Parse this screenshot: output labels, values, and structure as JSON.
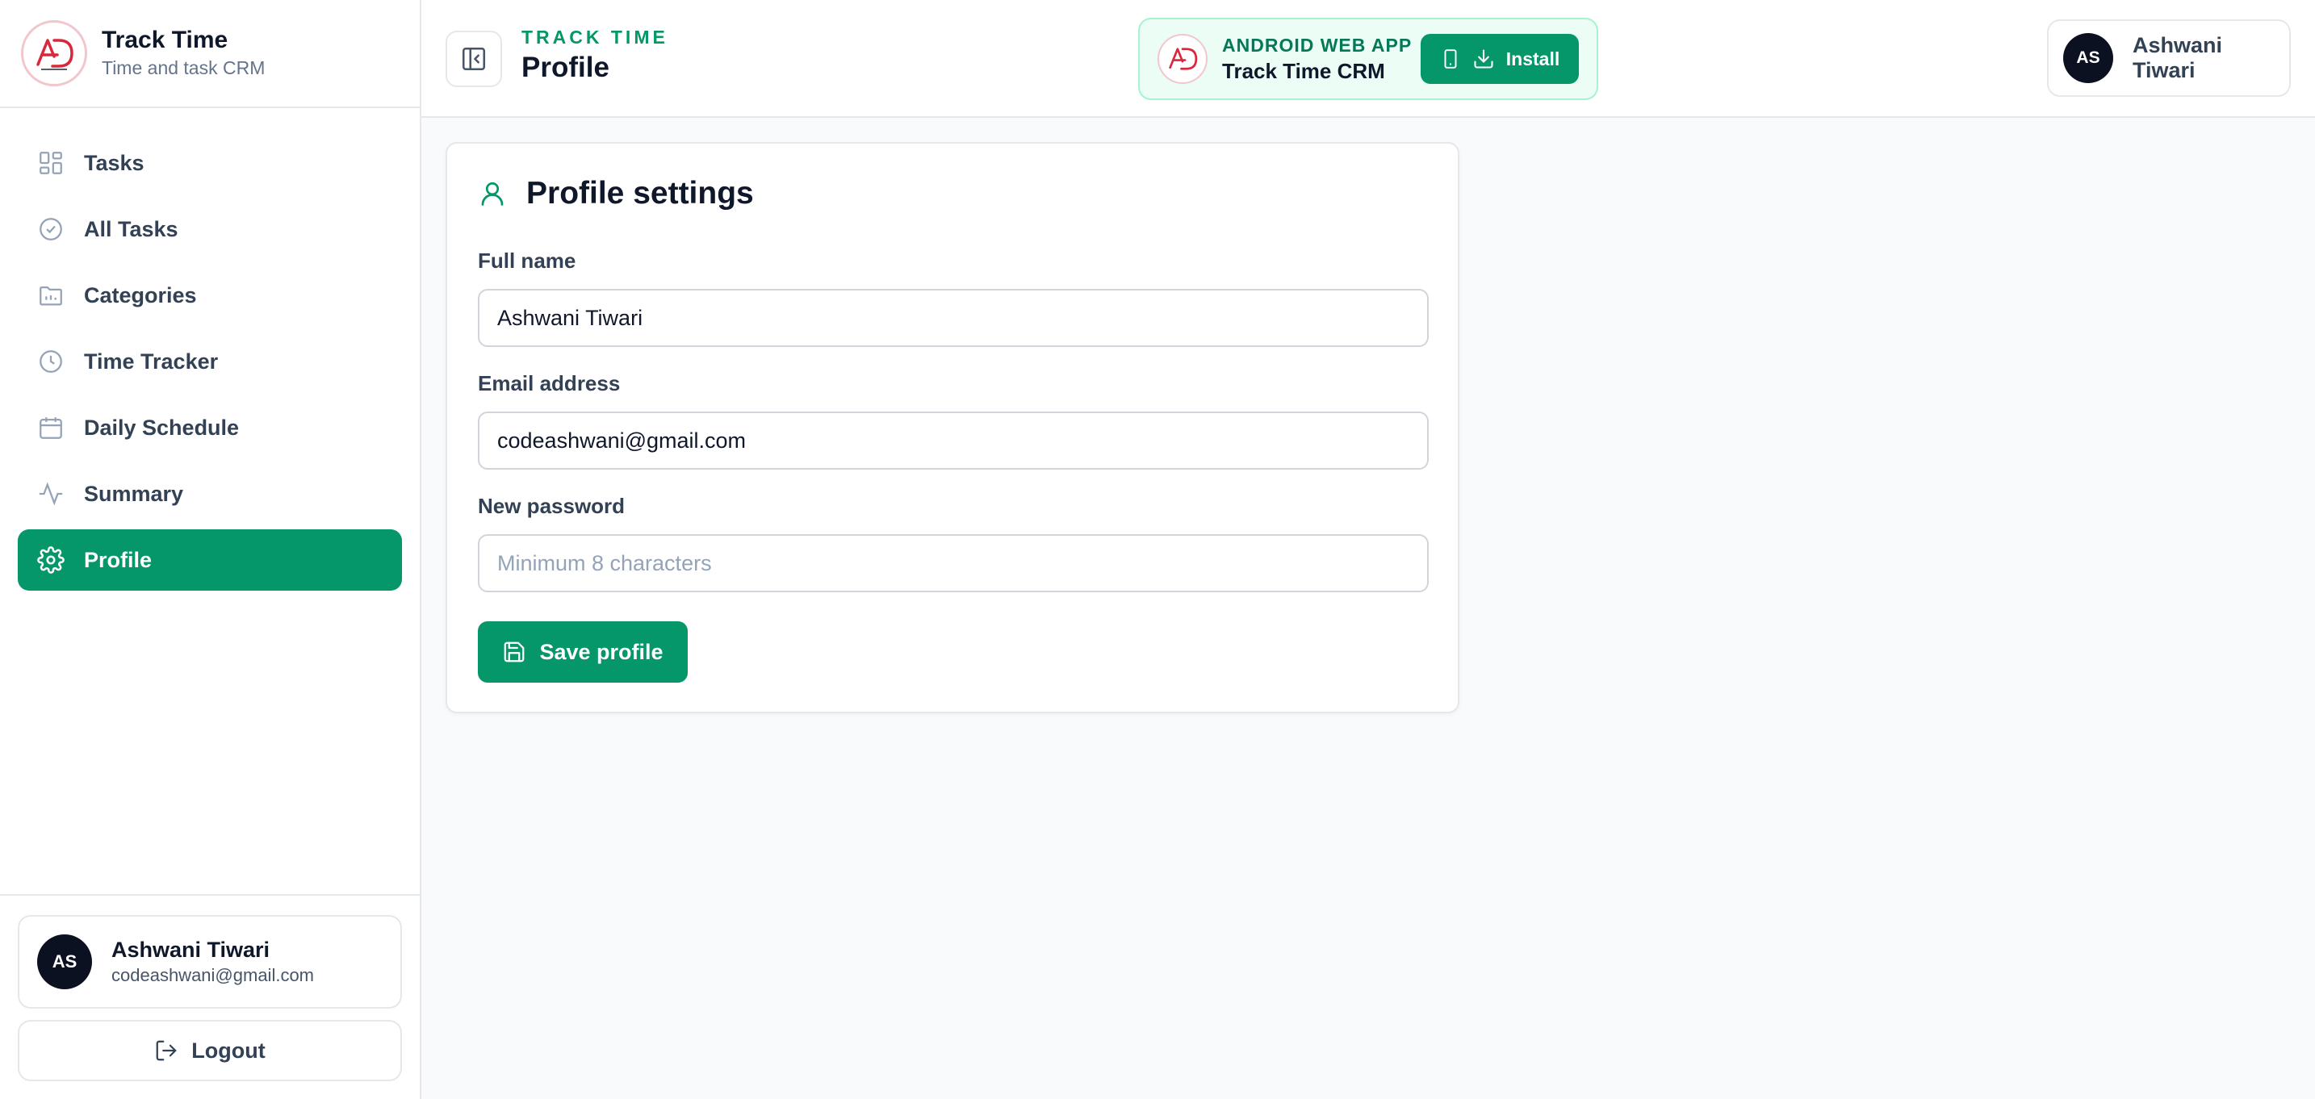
{
  "brand": {
    "title": "Track Time",
    "subtitle": "Time and task CRM",
    "logo_icon": "ad-logo-icon"
  },
  "sidebar": {
    "items": [
      {
        "label": "Tasks",
        "icon": "grid-icon",
        "active": false
      },
      {
        "label": "All Tasks",
        "icon": "check-circle-icon",
        "active": false
      },
      {
        "label": "Categories",
        "icon": "folder-icon",
        "active": false
      },
      {
        "label": "Time Tracker",
        "icon": "clock-icon",
        "active": false
      },
      {
        "label": "Daily Schedule",
        "icon": "calendar-icon",
        "active": false
      },
      {
        "label": "Summary",
        "icon": "activity-icon",
        "active": false
      },
      {
        "label": "Profile",
        "icon": "gear-icon",
        "active": true
      }
    ],
    "user": {
      "initials": "AS",
      "name": "Ashwani Tiwari",
      "email": "codeashwani@gmail.com"
    },
    "logout_label": "Logout"
  },
  "header": {
    "eyebrow": "TRACK TIME",
    "title": "Profile",
    "banner": {
      "eyebrow": "ANDROID WEB APP",
      "title": "Track Time CRM",
      "install_label": "Install"
    },
    "user": {
      "initials": "AS",
      "name": "Ashwani Tiwari"
    }
  },
  "profile": {
    "title": "Profile settings",
    "full_name_label": "Full name",
    "full_name_value": "Ashwani Tiwari",
    "email_label": "Email address",
    "email_value": "codeashwani@gmail.com",
    "password_label": "New password",
    "password_placeholder": "Minimum 8 characters",
    "save_label": "Save profile"
  },
  "colors": {
    "accent": "#059669",
    "accent_light": "#ecfdf5",
    "avatar_bg": "#0b1120"
  }
}
